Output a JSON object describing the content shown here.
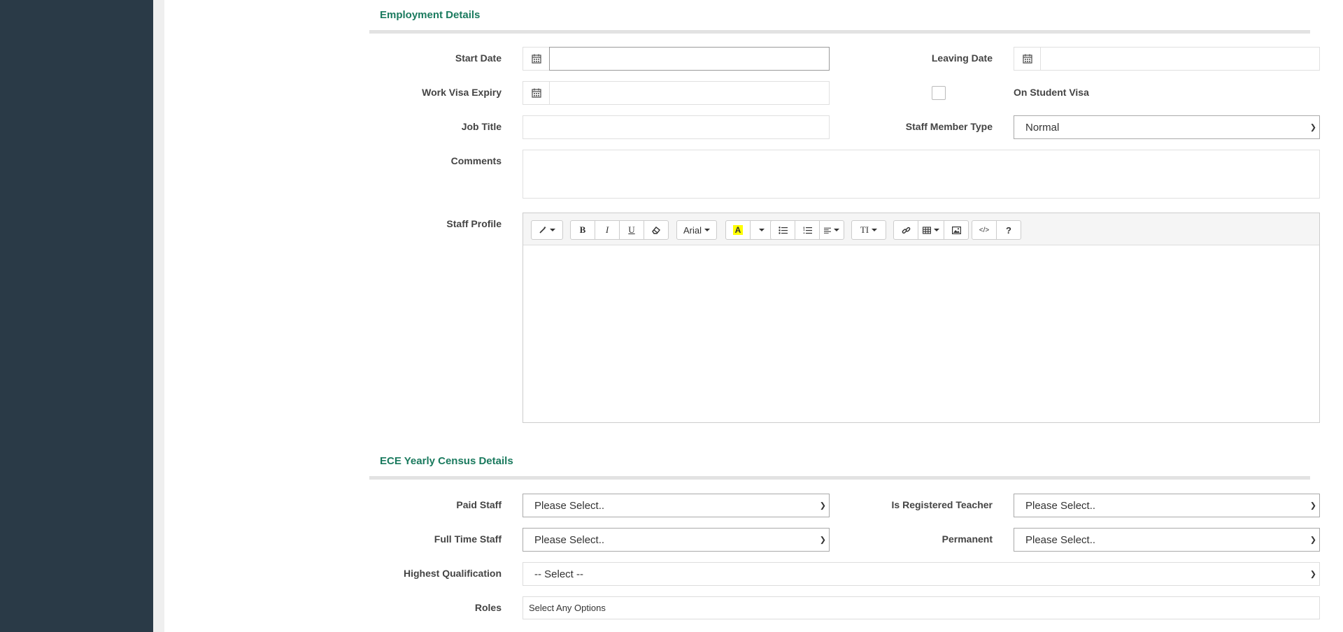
{
  "employment": {
    "section_title": "Employment Details",
    "start_date_label": "Start Date",
    "start_date_value": "",
    "leaving_date_label": "Leaving Date",
    "leaving_date_value": "",
    "work_visa_label": "Work Visa Expiry",
    "work_visa_value": "",
    "student_visa_label": "On Student Visa",
    "student_visa_checked": false,
    "job_title_label": "Job Title",
    "job_title_value": "",
    "staff_type_label": "Staff Member Type",
    "staff_type_value": "Normal",
    "comments_label": "Comments",
    "comments_value": "",
    "staff_profile_label": "Staff Profile"
  },
  "editor": {
    "font_name": "Arial",
    "bold": "B",
    "italic": "I",
    "underline": "U",
    "help": "?",
    "fontsize": "TI",
    "code": "</>",
    "highlight_color": "#ffff00"
  },
  "census": {
    "section_title": "ECE Yearly Census Details",
    "paid_staff_label": "Paid Staff",
    "paid_staff_value": "Please Select..",
    "registered_teacher_label": "Is Registered Teacher",
    "registered_teacher_value": "Please Select..",
    "full_time_label": "Full Time Staff",
    "full_time_value": "Please Select..",
    "permanent_label": "Permanent",
    "permanent_value": "Please Select..",
    "qualification_label": "Highest Qualification",
    "qualification_value": "-- Select --",
    "roles_label": "Roles",
    "roles_value": "Select Any Options"
  },
  "colors": {
    "sidebar": "#2a3a47",
    "section_title": "#1a7a5e"
  }
}
